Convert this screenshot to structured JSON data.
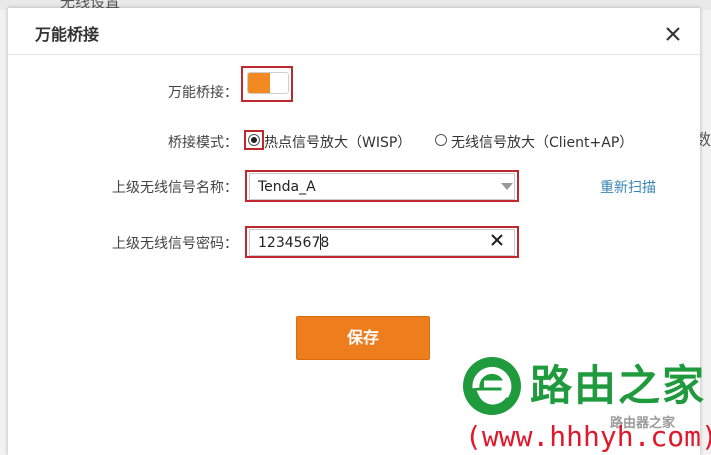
{
  "background": {
    "section_text": "无线设置",
    "right_char": "数"
  },
  "dialog": {
    "title": "万能桥接",
    "close_icon": "close-icon",
    "form": {
      "bridge_label": "万能桥接：",
      "bridge_enabled": true,
      "mode_label": "桥接模式：",
      "mode_options": [
        {
          "label": "热点信号放大（WISP）",
          "checked": true
        },
        {
          "label": "无线信号放大（Client+AP）",
          "checked": false
        }
      ],
      "ssid_label": "上级无线信号名称：",
      "ssid_value": "Tenda_A",
      "rescan_label": "重新扫描",
      "password_label": "上级无线信号密码：",
      "password_value": "12345678",
      "save_label": "保存"
    }
  },
  "watermark": {
    "brand": "路由之家",
    "sub": "路由器之家",
    "url": "(www.hhhyh.com)"
  },
  "colors": {
    "accent": "#ee7d1d",
    "highlight": "#c0282f",
    "link": "#3a86b6",
    "watermark_green": "#1f9a3c",
    "watermark_red": "#e0182c"
  }
}
